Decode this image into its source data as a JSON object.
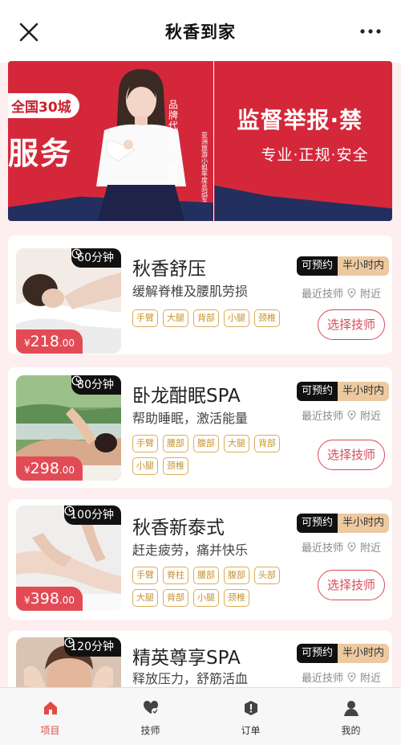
{
  "header": {
    "title": "秋香到家",
    "close_icon": "close-icon",
    "more_icon": "more-icon"
  },
  "banner": {
    "slide1": {
      "badge": "全国30城",
      "headline": "服务",
      "vertical_caption": "品牌代言人：夏双",
      "small_vertical": "亚洲旅游小姐年度总冠军"
    },
    "slide2": {
      "headline": "监督举报·禁",
      "subline": "专业·正规·安全"
    }
  },
  "colors": {
    "accent": "#e24b55",
    "tag_gold": "#c9932c",
    "banner_red": "#d4283a",
    "banner_navy": "#232f5e"
  },
  "services": [
    {
      "duration": "60分钟",
      "currency": "¥",
      "price": "218",
      "price_decimal": ".00",
      "name": "秋香舒压",
      "desc": "缓解脊椎及腰肌劳损",
      "tags": [
        "手臂",
        "大腿",
        "背部",
        "小腿",
        "颈椎"
      ],
      "status": "可预约",
      "time": "半小时内",
      "tech": "最近技师",
      "location": "附近",
      "button": "选择技师"
    },
    {
      "duration": "80分钟",
      "currency": "¥",
      "price": "298",
      "price_decimal": ".00",
      "name": "卧龙酣眠SPA",
      "desc": "帮助睡眠，激活能量",
      "tags": [
        "手臂",
        "腰部",
        "腹部",
        "大腿",
        "背部",
        "小腿",
        "颈椎"
      ],
      "status": "可预约",
      "time": "半小时内",
      "tech": "最近技师",
      "location": "附近",
      "button": "选择技师"
    },
    {
      "duration": "100分钟",
      "currency": "¥",
      "price": "398",
      "price_decimal": ".00",
      "name": "秋香新泰式",
      "desc": "赶走疲劳，痛并快乐",
      "tags": [
        "手臂",
        "脊柱",
        "腰部",
        "腹部",
        "头部",
        "大腿",
        "背部",
        "小腿",
        "颈椎"
      ],
      "status": "可预约",
      "time": "半小时内",
      "tech": "最近技师",
      "location": "附近",
      "button": "选择技师"
    },
    {
      "duration": "120分钟",
      "name": "精英尊享SPA",
      "desc": "释放压力，舒筋活血",
      "status": "可预约",
      "time": "半小时内",
      "tech": "最近技师",
      "location": "附近"
    }
  ],
  "tabbar": [
    {
      "label": "项目",
      "icon": "home-icon",
      "active": true
    },
    {
      "label": "技师",
      "icon": "heart-hands-icon",
      "active": false
    },
    {
      "label": "订单",
      "icon": "order-icon",
      "active": false
    },
    {
      "label": "我的",
      "icon": "user-icon",
      "active": false
    }
  ]
}
